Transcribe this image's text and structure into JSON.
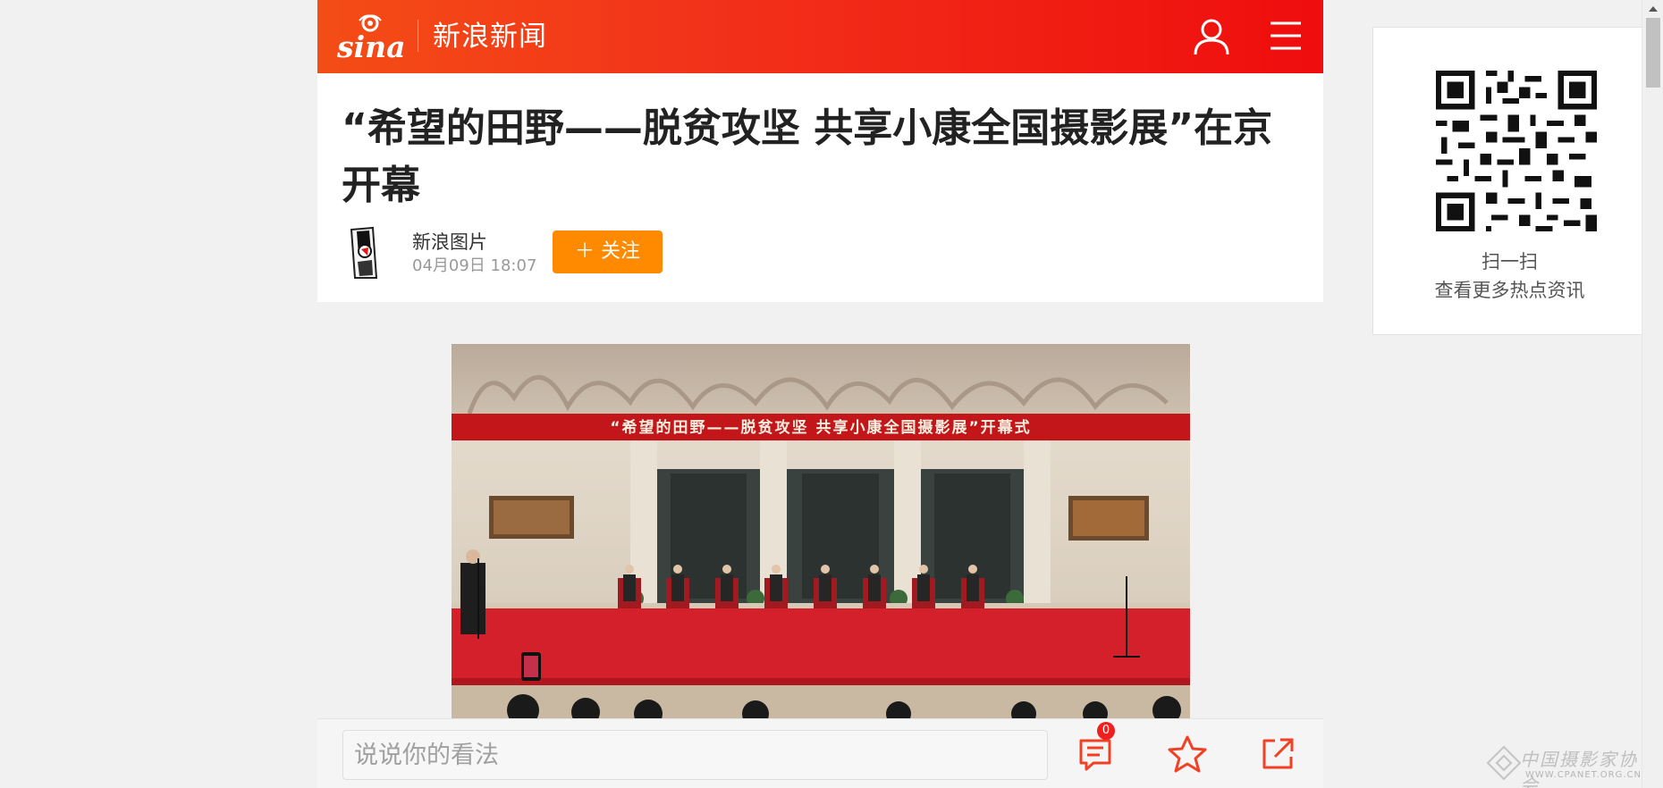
{
  "header": {
    "logo_text": "sina",
    "channel_name": "新浪新闻",
    "colors": {
      "gradient_start": "#f44d16",
      "gradient_end": "#ef0d0d"
    },
    "icons": [
      "user-icon",
      "menu-icon"
    ]
  },
  "article": {
    "title": "“希望的田野——脱贫攻坚 共享小康全国摄影展”在京开幕",
    "author": "新浪图片",
    "publish_time": "04月09日 18:07",
    "follow_label": "＋ 关注",
    "follow_color": "#ff8a00",
    "photo": {
      "banner_text": "“希望的田野——脱贫攻坚  共享小康全国摄影展”开幕式"
    }
  },
  "qr_card": {
    "line1": "扫一扫",
    "line2": "查看更多热点资讯"
  },
  "bottom_bar": {
    "comment_placeholder": "说说你的看法",
    "comment_count": "0",
    "icons": [
      "comment-icon",
      "star-icon",
      "share-icon"
    ],
    "accent": "#f04124"
  },
  "watermark": {
    "text": "中国摄影家协会",
    "url": "WWW.CPANET.ORG.CN"
  }
}
